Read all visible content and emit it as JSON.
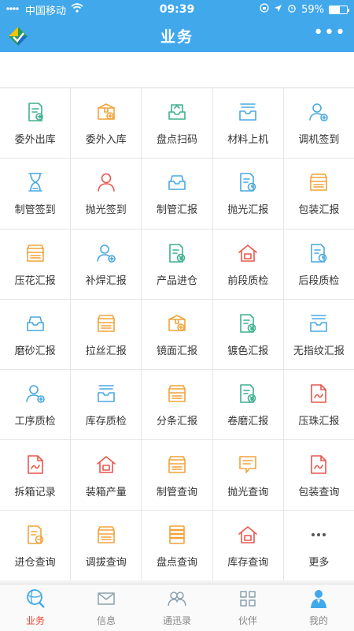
{
  "status": {
    "carrier": "中国移动",
    "time": "09:39",
    "battery": "59%",
    "battery_level": 0.59
  },
  "header": {
    "title": "业务",
    "more": "•••"
  },
  "colors": {
    "green": "#3fb08f",
    "orange": "#f1a33b",
    "blue": "#4aa8e0",
    "red": "#e8574d",
    "accent": "#41a8ec"
  },
  "grid": [
    {
      "label": "委外出库",
      "icon": "doc-out-icon",
      "color": "green"
    },
    {
      "label": "委外入库",
      "icon": "box-in-icon",
      "color": "orange"
    },
    {
      "label": "盘点扫码",
      "icon": "tray-scan-icon",
      "color": "green"
    },
    {
      "label": "材料上机",
      "icon": "inbox-icon",
      "color": "blue"
    },
    {
      "label": "调机签到",
      "icon": "user-add-icon",
      "color": "blue"
    },
    {
      "label": "制管签到",
      "icon": "hourglass-icon",
      "color": "blue"
    },
    {
      "label": "抛光签到",
      "icon": "user-icon",
      "color": "red"
    },
    {
      "label": "制管汇报",
      "icon": "tray-icon",
      "color": "blue"
    },
    {
      "label": "抛光汇报",
      "icon": "doc-clock-icon",
      "color": "blue"
    },
    {
      "label": "包装汇报",
      "icon": "box-icon",
      "color": "orange"
    },
    {
      "label": "压花汇报",
      "icon": "box-icon",
      "color": "orange"
    },
    {
      "label": "补焊汇报",
      "icon": "user-add-icon",
      "color": "blue"
    },
    {
      "label": "产品进仓",
      "icon": "doc-yen-icon",
      "color": "green"
    },
    {
      "label": "前段质检",
      "icon": "house-icon",
      "color": "red"
    },
    {
      "label": "后段质检",
      "icon": "doc-clock-icon",
      "color": "blue"
    },
    {
      "label": "磨砂汇报",
      "icon": "tray-icon",
      "color": "blue"
    },
    {
      "label": "拉丝汇报",
      "icon": "box-icon",
      "color": "orange"
    },
    {
      "label": "镜面汇报",
      "icon": "box-in-icon",
      "color": "orange"
    },
    {
      "label": "镀色汇报",
      "icon": "doc-yen-icon",
      "color": "green"
    },
    {
      "label": "无指纹汇报",
      "icon": "inbox-icon",
      "color": "blue"
    },
    {
      "label": "工序质检",
      "icon": "user-add-icon",
      "color": "blue"
    },
    {
      "label": "库存质检",
      "icon": "inbox-icon",
      "color": "blue"
    },
    {
      "label": "分条汇报",
      "icon": "box-icon",
      "color": "orange"
    },
    {
      "label": "卷磨汇报",
      "icon": "doc-yen-icon",
      "color": "green"
    },
    {
      "label": "压珠汇报",
      "icon": "doc-sign-icon",
      "color": "red"
    },
    {
      "label": "拆箱记录",
      "icon": "doc-sign-icon",
      "color": "red"
    },
    {
      "label": "装箱产量",
      "icon": "house-icon",
      "color": "red"
    },
    {
      "label": "制管查询",
      "icon": "box-icon",
      "color": "orange"
    },
    {
      "label": "抛光查询",
      "icon": "chat-icon",
      "color": "orange"
    },
    {
      "label": "包装查询",
      "icon": "doc-sign-icon",
      "color": "red"
    },
    {
      "label": "进仓查询",
      "icon": "doc-minus-icon",
      "color": "orange"
    },
    {
      "label": "调拔查询",
      "icon": "box-icon",
      "color": "orange"
    },
    {
      "label": "盘点查询",
      "icon": "list-icon",
      "color": "orange"
    },
    {
      "label": "库存查询",
      "icon": "house-icon",
      "color": "red"
    },
    {
      "label": "更多",
      "icon": "dots-icon",
      "color": "gray"
    }
  ],
  "tabs": [
    {
      "label": "业务",
      "icon": "globe-search-icon",
      "active": true
    },
    {
      "label": "信息",
      "icon": "mail-icon",
      "active": false
    },
    {
      "label": "通迅录",
      "icon": "contacts-icon",
      "active": false
    },
    {
      "label": "伙伴",
      "icon": "apps-icon",
      "active": false
    },
    {
      "label": "我的",
      "icon": "profile-icon",
      "active": false
    }
  ]
}
